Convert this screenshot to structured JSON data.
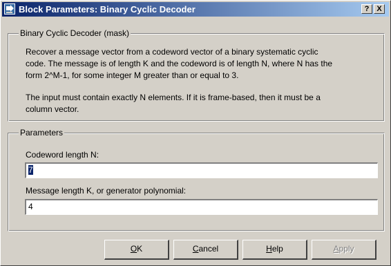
{
  "window": {
    "title": "Block Parameters: Binary Cyclic Decoder",
    "help_glyph": "?",
    "close_glyph": "X"
  },
  "description": {
    "group_title": "Binary Cyclic Decoder (mask)",
    "para1_line1": "Recover a message vector from a codeword vector of a binary systematic cyclic",
    "para1_line2": "code.  The message is of length K and the codeword is of length N, where N has the",
    "para1_line3": "form 2^M-1, for some integer M greater than or equal to 3.",
    "para2_line1": "The input must contain exactly N elements.  If it is frame-based, then it must be a",
    "para2_line2": "column vector."
  },
  "parameters": {
    "group_title": "Parameters",
    "codeword_label": "Codeword length N:",
    "codeword_value": "7",
    "message_label": "Message length K, or generator polynomial:",
    "message_value": "4"
  },
  "buttons": {
    "ok": {
      "mnemonic": "O",
      "rest": "K"
    },
    "cancel": {
      "mnemonic": "C",
      "rest": "ancel"
    },
    "help": {
      "mnemonic": "H",
      "rest": "elp"
    },
    "apply": {
      "mnemonic": "A",
      "rest": "pply"
    }
  },
  "icons": {
    "app": "simulink-block-icon",
    "help": "help-question-icon",
    "close": "close-x-icon"
  }
}
